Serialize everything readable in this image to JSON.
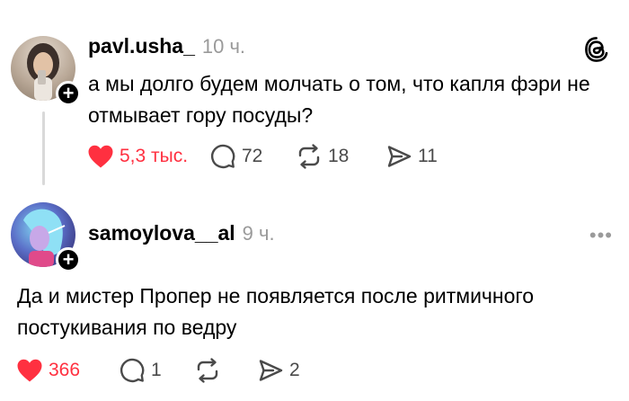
{
  "posts": [
    {
      "username": "pavl.usha_",
      "time": "10 ч.",
      "text": "а мы долго будем молчать о том, что капля фэри не отмывает гору посуды?",
      "likes": "5,3 тыс.",
      "replies": "72",
      "reposts": "18",
      "shares": "11",
      "follow_symbol": "+"
    },
    {
      "username": "samoylova__al",
      "time": "9 ч.",
      "text": "Да и мистер Пропер не появляется после ритмичного постукивания по ведру",
      "likes": "366",
      "replies": "1",
      "reposts": "",
      "shares": "2",
      "follow_symbol": "+",
      "more_menu": "•••"
    }
  ],
  "colors": {
    "like": "#ff3040",
    "muted": "#9a9a9a",
    "icon": "#4a4a4a"
  },
  "icons": [
    "heart-filled-icon",
    "reply-bubble-icon",
    "repost-icon",
    "share-send-icon",
    "threads-logo",
    "more-dots-icon"
  ]
}
